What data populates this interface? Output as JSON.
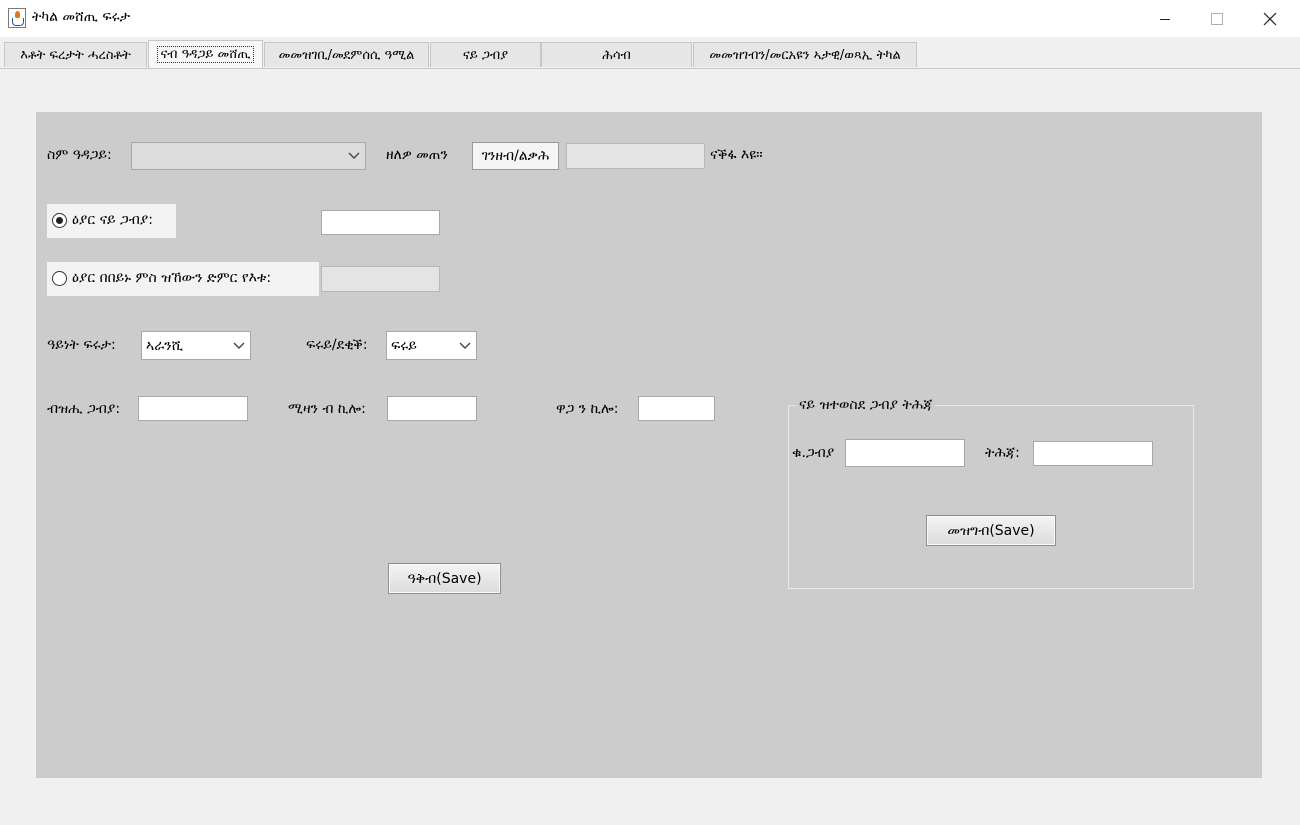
{
  "window": {
    "title": "ትካል መሸጢ ፍሩታ",
    "controls": {
      "minimize": "minimize-icon",
      "maximize": "maximize-icon",
      "close": "close-icon"
    }
  },
  "tabs": [
    {
      "label": "እቶት ፍረታት ሓረስቶት",
      "active": false
    },
    {
      "label": "ናብ ዓዳጋይ መሸጢ",
      "active": true
    },
    {
      "label": "መመዝገቢ/መደምሰሲ ዓሚል",
      "active": false
    },
    {
      "label": "ናይ ጋብያ",
      "active": false
    },
    {
      "label": "ሕሳብ",
      "active": false
    },
    {
      "label": "መመዝገብን/መርአዩን ኣታዊ/ወጻኢ ትካል",
      "active": false
    }
  ],
  "form": {
    "customer_label": "ስም ዓዳጋይ:",
    "customer_value": "",
    "remaining_label": "ዘለዎ መጠን",
    "remaining_unit": "ገንዘብ/ልቃሕ",
    "remaining_value": "",
    "remaining_suffix": "ናቕፋ እዩ።",
    "radio_crate_label": "ዕያር ናይ ጋብያ:",
    "radio_crate_value": "",
    "radio_total_label": "ዕያር በበይኑ ምስ ዝኸውን ድምር የእቱ:",
    "radio_total_value": "",
    "fruit_type_label": "ዓይነት ፍሩታ:",
    "fruit_type_value": "ኣራንሺ",
    "quality_label": "ፍሩይ/ደቂቕ:",
    "quality_value": "ፍሩይ",
    "crate_count_label": "ብዝሒ ጋብያ:",
    "crate_count_value": "",
    "weight_label": "ሚዛን ብ ኪሎ:",
    "weight_value": "",
    "price_label": "ዋጋ ን ኪሎ:",
    "price_value": "",
    "save_button": "ዓቅብ(Save)"
  },
  "crate_group": {
    "title": "ናይ ዝተወስደ ጋብያ ትሕጃ",
    "crate_no_label": "ቁ.ጋብያ",
    "crate_no_value": "",
    "deposit_label": "ትሕጃ:",
    "deposit_value": "",
    "save_button": "መዝግብ(Save)"
  }
}
